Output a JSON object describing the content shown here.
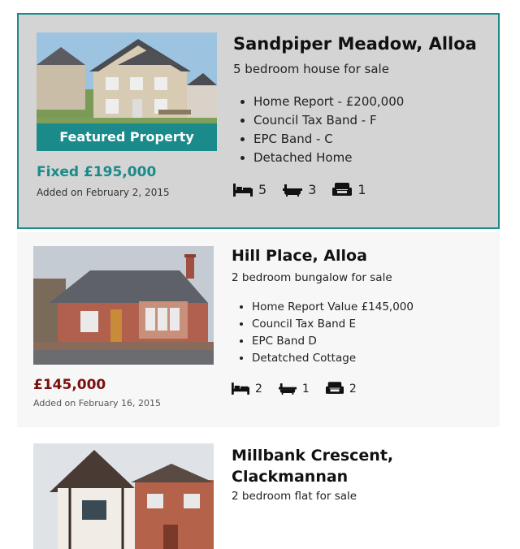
{
  "listings": [
    {
      "featured_label": "Featured Property",
      "title": "Sandpiper Meadow, Alloa",
      "subtitle": "5 bedroom house for sale",
      "features": [
        "Home Report - £200,000",
        "Council Tax Band - F",
        "EPC Band - C",
        "Detached Home"
      ],
      "price": "Fixed £195,000",
      "added": "Added on February 2, 2015",
      "bedrooms": "5",
      "bathrooms": "3",
      "receptions": "1",
      "price_color": "#1a8a8a"
    },
    {
      "title": "Hill Place, Alloa",
      "subtitle": "2 bedroom bungalow for sale",
      "features": [
        "Home Report Value £145,000",
        "Council Tax Band E",
        "EPC Band D",
        "Detatched Cottage"
      ],
      "price": "£145,000",
      "added": "Added on February 16, 2015",
      "bedrooms": "2",
      "bathrooms": "1",
      "receptions": "2",
      "price_color": "#7a0f0f"
    },
    {
      "title": "Millbank Crescent, Clackmannan",
      "subtitle": "2 bedroom flat for sale"
    }
  ],
  "icons": {
    "bed": "bed-icon",
    "bath": "bath-icon",
    "sofa": "sofa-icon"
  },
  "colors": {
    "accent": "#1a8a8a",
    "featured_bg": "#d4d4d4",
    "price_red": "#7a0f0f"
  }
}
